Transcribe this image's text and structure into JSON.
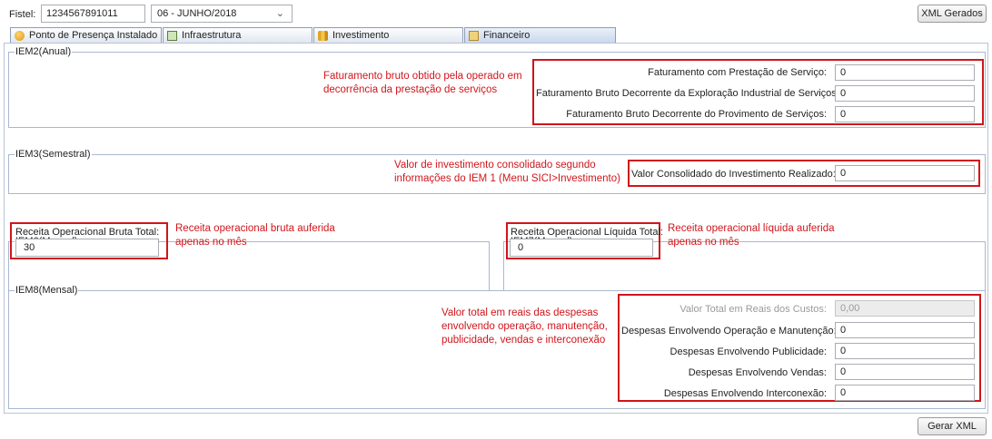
{
  "header": {
    "fistel_label": "Fistel:",
    "fistel_value": "1234567891011",
    "period_value": "06 - JUNHO/2018",
    "xml_button": "XML Gerados"
  },
  "tabs": [
    {
      "label": "Ponto de Presença Instalado"
    },
    {
      "label": "Infraestrutura"
    },
    {
      "label": "Investimento"
    },
    {
      "label": "Financeiro"
    }
  ],
  "iem2": {
    "legend": "IEM2(Anual)",
    "note": "Faturamento bruto obtido pela operado em decorrência da prestação de serviços",
    "fields": [
      {
        "label": "Faturamento com Prestação de Serviço:",
        "value": "0"
      },
      {
        "label": "Faturamento Bruto Decorrente da Exploração Industrial de Serviços:",
        "value": "0"
      },
      {
        "label": "Faturamento Bruto Decorrente do Provimento de Serviços:",
        "value": "0"
      }
    ]
  },
  "iem3": {
    "legend": "IEM3(Semestral)",
    "note_line1": "Valor de investimento consolidado segundo",
    "note_line2": "informações do IEM 1 (Menu SICI>Investimento)",
    "field": {
      "label": "Valor Consolidado do Investimento Realizado:",
      "value": "0"
    }
  },
  "iem6": {
    "legend": "IEM6(Mensal)",
    "field": {
      "label": "Receita Operacional Bruta Total:",
      "value": "30"
    },
    "note": "Receita operacional bruta auferida apenas no mês"
  },
  "iem7": {
    "legend": "IEM7(Mensal)",
    "field": {
      "label": "Receita Operacional Líquida Total:",
      "value": "0"
    },
    "note": "Receita operacional líquida auferida apenas no mês"
  },
  "iem8": {
    "legend": "IEM8(Mensal)",
    "note": "Valor total em reais das despesas envolvendo operação, manutenção, publicidade, vendas e interconexão",
    "fields": [
      {
        "label": "Valor Total em Reais dos Custos:",
        "value": "0,00",
        "disabled": true
      },
      {
        "label": "Despesas Envolvendo Operação e Manutenção:",
        "value": "0"
      },
      {
        "label": "Despesas Envolvendo Publicidade:",
        "value": "0"
      },
      {
        "label": "Despesas Envolvendo Vendas:",
        "value": "0"
      },
      {
        "label": "Despesas Envolvendo Interconexão:",
        "value": "0"
      }
    ]
  },
  "footer": {
    "generate_button": "Gerar XML"
  },
  "colors": {
    "annotation": "#d0151b",
    "border": "#a9b8cf"
  }
}
